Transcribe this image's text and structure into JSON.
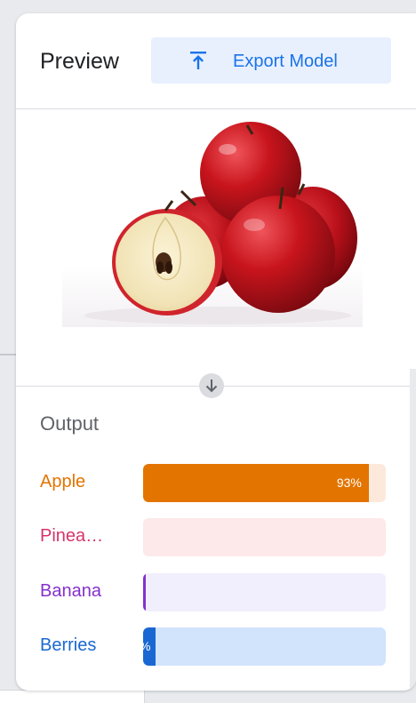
{
  "header": {
    "title": "Preview",
    "export_label": "Export Model",
    "export_icon": "upload-icon"
  },
  "preview": {
    "image_icon": "apple-photo",
    "arrow_icon": "arrow-down-icon"
  },
  "output": {
    "title": "Output",
    "classes": [
      {
        "label": "Apple",
        "percent": 93,
        "percent_text": "93%",
        "color": "#e37400",
        "track": "#fde9dc"
      },
      {
        "label": "Pinea…",
        "percent": 0,
        "percent_text": "",
        "color": "#d6336c",
        "track": "#fde8ea"
      },
      {
        "label": "Banana",
        "percent": 1,
        "percent_text": "",
        "color": "#8430ce",
        "track": "#f1effd"
      },
      {
        "label": "Berries",
        "percent": 5,
        "percent_text": "%",
        "color": "#1967d2",
        "track": "#d2e3fc"
      }
    ]
  },
  "colors": {
    "accent": "#1a73e8",
    "button_bg": "#e8f0fe"
  }
}
